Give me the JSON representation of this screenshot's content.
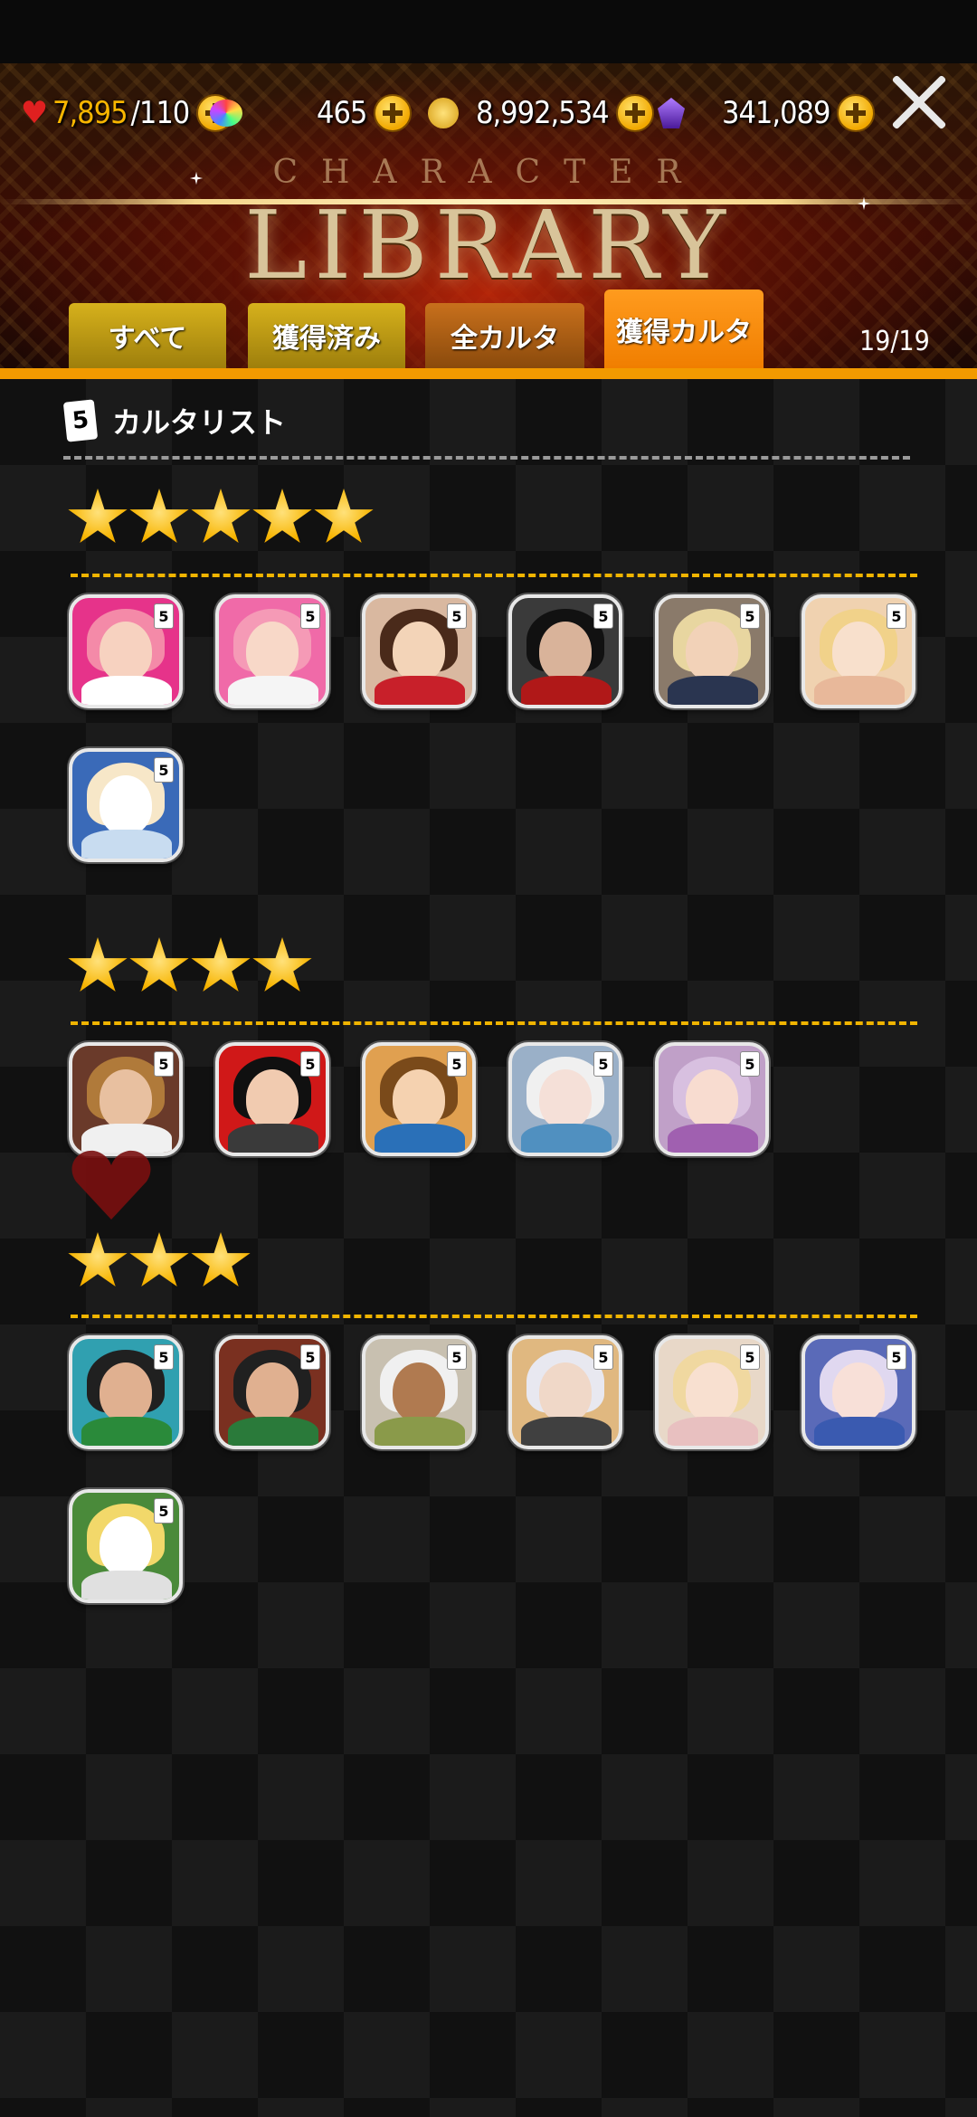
{
  "resources": {
    "stamina": "7,895",
    "stamina_max": "/110",
    "gems": "465",
    "gold": "8,992,534",
    "crystals": "341,089"
  },
  "header": {
    "title_small": "CHARACTER",
    "title_big": "LIBRARY"
  },
  "tabs": [
    {
      "label": "すべて"
    },
    {
      "label": "獲得済み"
    },
    {
      "label": "全カルタ"
    },
    {
      "label": "獲得カルタ"
    }
  ],
  "active_tab": "獲得カルタ",
  "count": "19/19",
  "list": {
    "icon_text": "5",
    "title": "カルタリスト"
  },
  "groups": [
    {
      "stars": 5,
      "cards": [
        {
          "bg": "#e6338a",
          "hair": "#f48aa8",
          "skin": "#f7d2c0",
          "body": "#ffffff"
        },
        {
          "bg": "#f06aa8",
          "hair": "#f59ab6",
          "skin": "#f8d8c8",
          "body": "#f5f5f5"
        },
        {
          "bg": "#d9b8a0",
          "hair": "#4a2a1a",
          "skin": "#f3d4b8",
          "body": "#c8202a"
        },
        {
          "bg": "#3a3a3a",
          "hair": "#111111",
          "skin": "#d9b39a",
          "body": "#b01818"
        },
        {
          "bg": "#8a7a6a",
          "hair": "#e8d6a0",
          "skin": "#f2d2b8",
          "body": "#2a3550"
        },
        {
          "bg": "#f0d2b0",
          "hair": "#f1d28a",
          "skin": "#f8e0cc",
          "body": "#e8b89a"
        },
        {
          "bg": "#3a6ab8",
          "hair": "#f7e7c8",
          "skin": "#ffffff",
          "body": "#c8dcf0"
        }
      ]
    },
    {
      "stars": 4,
      "cards": [
        {
          "bg": "#6a3a2a",
          "hair": "#b07a3a",
          "skin": "#e8c0a0",
          "body": "#f0f0f0"
        },
        {
          "bg": "#d01818",
          "hair": "#101010",
          "skin": "#f1cbb0",
          "body": "#3a3a3a"
        },
        {
          "bg": "#e0a050",
          "hair": "#7a4a1a",
          "skin": "#f5d2b0",
          "body": "#2a70b8"
        },
        {
          "bg": "#9ab0c8",
          "hair": "#f0f0f0",
          "skin": "#f5e0d8",
          "body": "#5090c0"
        },
        {
          "bg": "#c0a0c8",
          "hair": "#d8c0e0",
          "skin": "#f8dcd0",
          "body": "#a060b0"
        }
      ]
    },
    {
      "stars": 3,
      "cards": [
        {
          "bg": "#30a0b0",
          "hair": "#202020",
          "skin": "#e0b090",
          "body": "#2a8a3a"
        },
        {
          "bg": "#7a3020",
          "hair": "#202020",
          "skin": "#e0b090",
          "body": "#2a7a3a"
        },
        {
          "bg": "#c8c0b0",
          "hair": "#f0f0f0",
          "skin": "#b07a50",
          "body": "#8a9a4a"
        },
        {
          "bg": "#e0b880",
          "hair": "#e8e8f0",
          "skin": "#f0d8c8",
          "body": "#404040"
        },
        {
          "bg": "#e8d8c8",
          "hair": "#f0d8a0",
          "skin": "#f8e0d0",
          "body": "#e8c0c0"
        },
        {
          "bg": "#5a6ab8",
          "hair": "#e0d8f0",
          "skin": "#f8e0d8",
          "body": "#3a5ab0"
        },
        {
          "bg": "#4a8a3a",
          "hair": "#f2d86a",
          "skin": "#ffffff",
          "body": "#e0e0e0"
        }
      ]
    }
  ]
}
